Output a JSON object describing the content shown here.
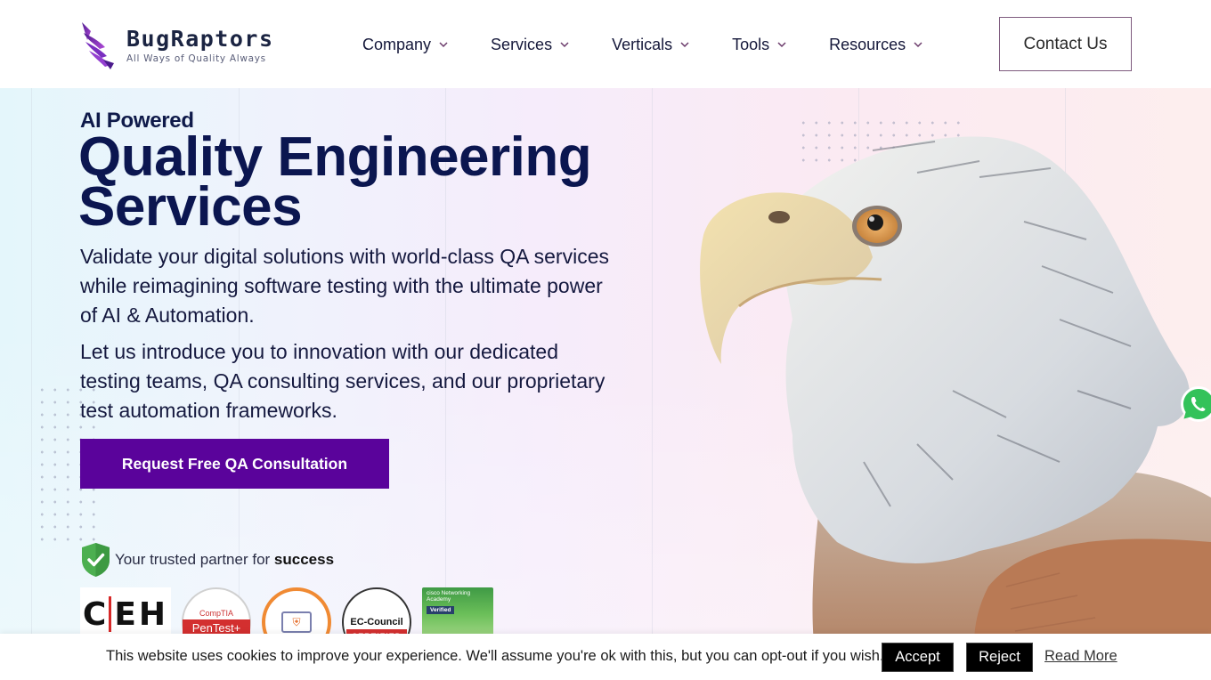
{
  "brand": {
    "name": "BugRaptors",
    "tagline": "All Ways of Quality Always",
    "accent_color": "#5a039b"
  },
  "nav": {
    "items": [
      {
        "label": "Company",
        "icon": "chevron-down-icon"
      },
      {
        "label": "Services",
        "icon": "chevron-down-icon"
      },
      {
        "label": "Verticals",
        "icon": "chevron-down-icon"
      },
      {
        "label": "Tools",
        "icon": "chevron-down-icon"
      },
      {
        "label": "Resources",
        "icon": "chevron-down-icon"
      }
    ],
    "contact_label": "Contact Us"
  },
  "hero": {
    "eyebrow": "AI Powered",
    "title_line1": "Quality Engineering",
    "title_line2": "Services",
    "paragraph1": "Validate your digital solutions with world-class QA services while reimagining software testing with the ultimate power of AI & Automation.",
    "paragraph2": "Let us introduce you to innovation with our dedicated testing teams, QA consulting services, and our proprietary test automation frameworks.",
    "cta_label": "Request Free QA Consultation",
    "trust_prefix": "Your trusted partner for ",
    "trust_emphasis": "success",
    "badges": {
      "ceh": "CEH",
      "pentest_top": "CompTIA",
      "pentest_main": "PenTest+",
      "ecc_name": "EC-Council",
      "ecc_cert": "CERTIFIED",
      "cisco_top": "cisco Networking Academy",
      "cisco_verified": "Verified"
    }
  },
  "cookie": {
    "text": "This website uses cookies to improve your experience. We'll assume you're ok with this, but you can opt-out if you wish.",
    "accept_label": "Accept",
    "reject_label": "Reject",
    "read_more_label": "Read More"
  }
}
